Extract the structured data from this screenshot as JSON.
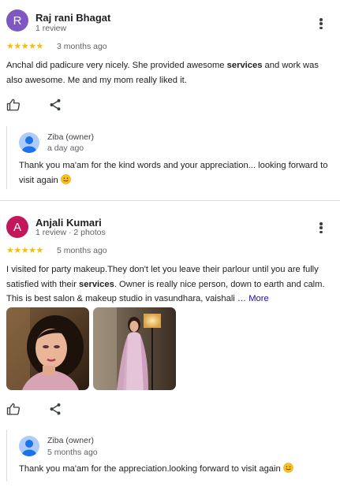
{
  "reviews": [
    {
      "initial": "R",
      "avatar_color": "#7e57c2",
      "name": "Raj rani Bhagat",
      "meta": "1 review",
      "stars": "★★★★★",
      "time": "3 months ago",
      "text_parts": [
        "Anchal did padicure very nicely. She provided awesome ",
        "services",
        " and work was also awesome. Me and my mom really liked it."
      ],
      "reply": {
        "owner": "Ziba (owner)",
        "time": "a day ago",
        "text": "Thank you ma'am for the kind words and your appreciation... looking forward to visit again"
      }
    },
    {
      "initial": "A",
      "avatar_color": "#c2185b",
      "name": "Anjali Kumari",
      "meta": "1 review · 2 photos",
      "stars": "★★★★★",
      "time": "5 months ago",
      "text_parts": [
        "I visited for party makeup.They don't let you leave their parlour until you are fully satisfied with their ",
        "services",
        ". Owner is really nice person, down to earth and calm. This is best salon & makeup studio in vasundhara, vaishali … "
      ],
      "more_label": "More",
      "reply": {
        "owner": "Ziba (owner)",
        "time": "5 months ago",
        "text": "Thank you ma'am for the appreciation.looking forward to visit again"
      }
    }
  ],
  "icons": [
    "more-vert-icon",
    "star-icon",
    "thumb-up-icon",
    "share-icon",
    "owner-avatar-icon",
    "smiley-emoji-icon"
  ],
  "colors": {
    "star": "#fbbc04",
    "link": "#1a0dab",
    "divider": "#dadce0"
  }
}
